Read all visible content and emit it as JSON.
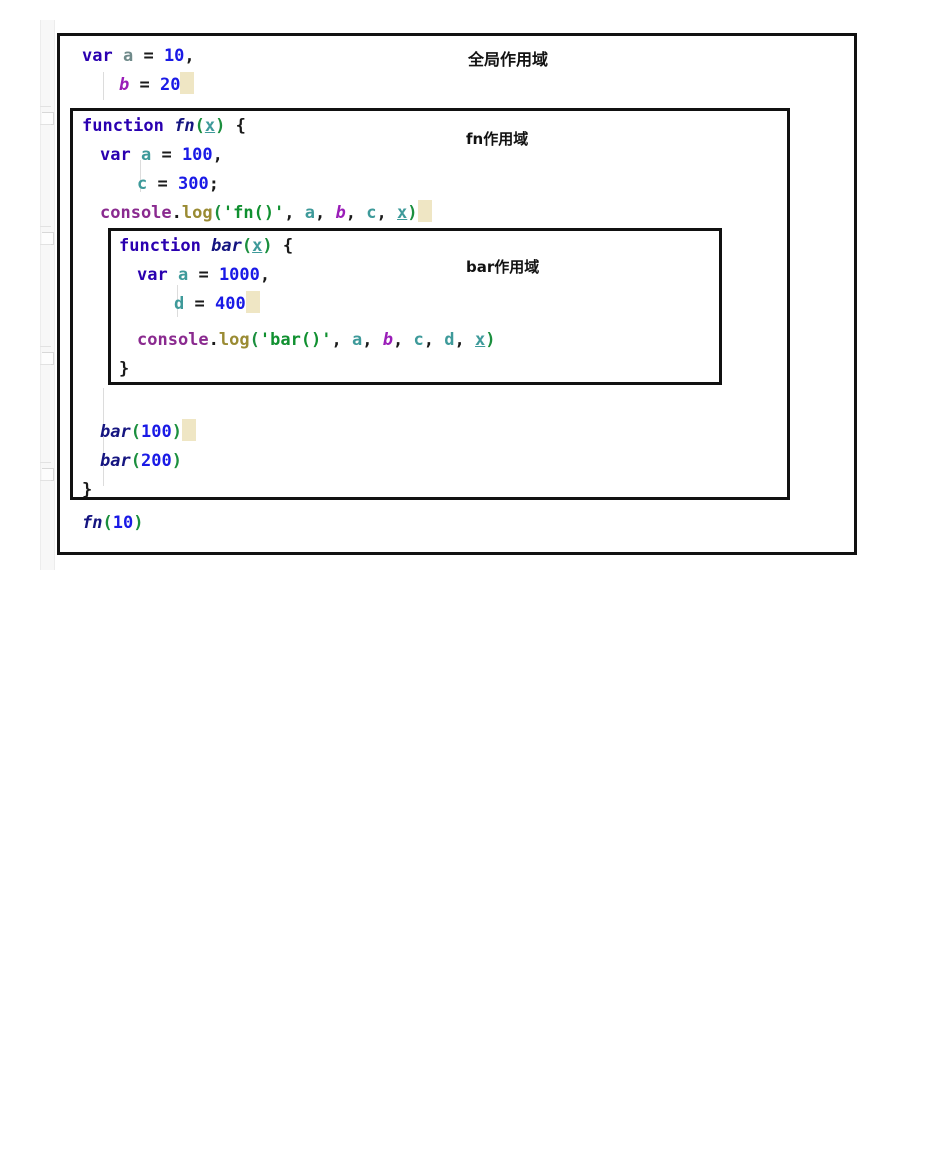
{
  "editor": {
    "language": "javascript",
    "gutter": {
      "fold_markers": 4
    }
  },
  "annotations": {
    "global_scope": "全局作用域",
    "fn_scope": "fn作用域",
    "bar_scope": "bar作用域"
  },
  "colors": {
    "keyword": "#2a00b0",
    "number": "#1a1ae6",
    "string": "#109030",
    "object": "#8a2a8f",
    "method": "#9a8b33",
    "paren": "#1b8f3e",
    "function_name": "#151580",
    "param": "#3e9a9a",
    "var_a": "#6f8a8a",
    "var_b": "#9a1db8",
    "var_c": "#3e9a9a",
    "var_d": "#3e9a9a",
    "highlight": "#efe6c4",
    "box_border": "#111111",
    "background": "#ffffff"
  },
  "code": {
    "line1": {
      "kw": "var",
      "name": "a",
      "eq": " = ",
      "value": "10",
      "comma": ","
    },
    "line2": {
      "name": "b",
      "eq": " = ",
      "value": "20"
    },
    "line3": {
      "kw": "function",
      "name": "fn",
      "open": "(",
      "param": "x",
      "close": ")",
      "brace": " {"
    },
    "line4": {
      "kw": "var",
      "name": "a",
      "eq": " = ",
      "value": "100",
      "comma": ","
    },
    "line5": {
      "name": "c",
      "eq": " = ",
      "value": "300",
      "semi": ";"
    },
    "line6": {
      "obj": "console",
      "dot": ".",
      "meth": "log",
      "open": "(",
      "str": "'fn()'",
      "args": ", a, b, c, x",
      "close": ")"
    },
    "line7": {
      "kw": "function",
      "name": "bar",
      "open": "(",
      "param": "x",
      "close": ")",
      "brace": " {"
    },
    "line8": {
      "kw": "var",
      "name": "a",
      "eq": " = ",
      "value": "1000",
      "comma": ","
    },
    "line9": {
      "name": "d",
      "eq": " = ",
      "value": "400"
    },
    "line10": {
      "obj": "console",
      "dot": ".",
      "meth": "log",
      "open": "(",
      "str": "'bar()'",
      "args": ", a, b, c, d, x",
      "close": ")"
    },
    "line11": {
      "brace": "}"
    },
    "line12": {
      "name": "bar",
      "open": "(",
      "value": "100",
      "close": ")"
    },
    "line13": {
      "name": "bar",
      "open": "(",
      "value": "200",
      "close": ")"
    },
    "line14": {
      "brace": "}"
    },
    "line15": {
      "name": "fn",
      "open": "(",
      "value": "10",
      "close": ")"
    }
  },
  "tokens": {
    "var": "var",
    "function": "function",
    "console": "console",
    "log": "log",
    "dot": ".",
    "eq": "=",
    "comma": ",",
    "semi": ";",
    "lparen": "(",
    "rparen": ")",
    "lbrace": "{",
    "rbrace": "}",
    "a": "a",
    "b": "b",
    "c": "c",
    "d": "d",
    "x": "x",
    "fn": "fn",
    "bar": "bar",
    "str_fn": "'fn()'",
    "str_bar": "'bar()'",
    "n10": "10",
    "n20": "20",
    "n100": "100",
    "n200": "200",
    "n300": "300",
    "n400": "400",
    "n1000": "1000"
  }
}
